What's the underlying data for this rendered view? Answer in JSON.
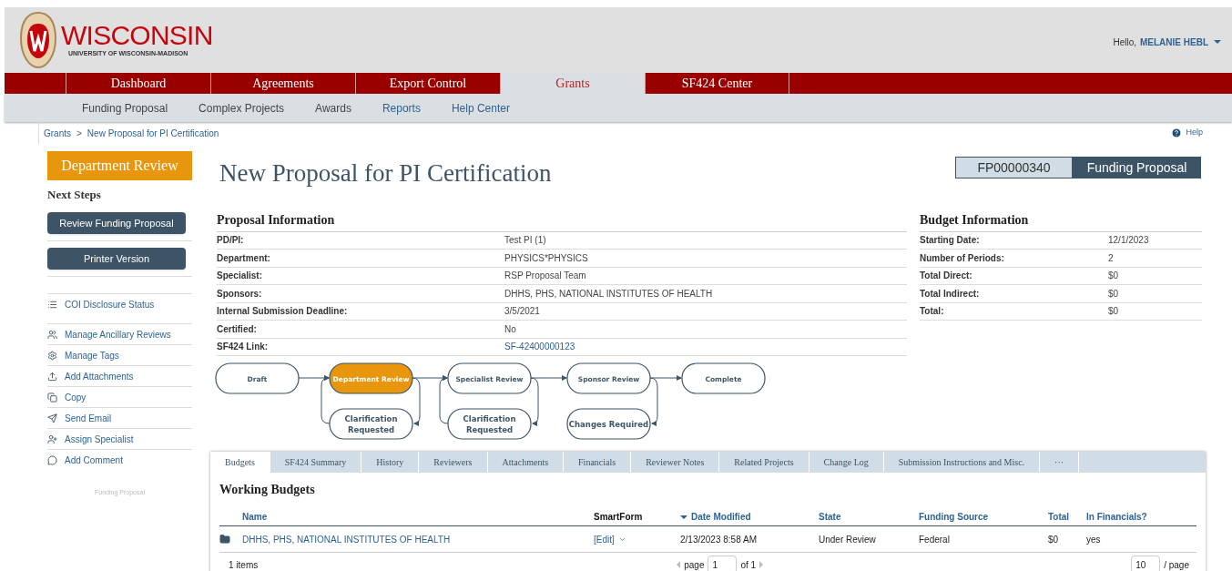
{
  "header": {
    "logo_title": "WISCONSIN",
    "logo_subtitle": "UNIVERSITY OF WISCONSIN-MADISON",
    "greeting": "Hello,",
    "user": "MELANIE HEBL"
  },
  "nav": [
    {
      "label": "Dashboard",
      "selected": false
    },
    {
      "label": "Agreements",
      "selected": false
    },
    {
      "label": "Export Control",
      "selected": false
    },
    {
      "label": "Grants",
      "selected": true
    },
    {
      "label": "SF424 Center",
      "selected": false
    }
  ],
  "subnav": [
    "Funding Proposal",
    "Complex Projects",
    "Awards",
    "Reports",
    "Help Center"
  ],
  "breadcrumb": {
    "items": [
      "Grants",
      "New Proposal for PI Certification"
    ],
    "separator": ">"
  },
  "help": "Help",
  "sidebar": {
    "state": "Department Review",
    "next_steps_title": "Next Steps",
    "buttons": [
      "Review Funding Proposal",
      "Printer Version"
    ],
    "actions": [
      {
        "kind": "list",
        "label": "COI Disclosure Status"
      },
      {
        "kind": "users",
        "label": "Manage Ancillary Reviews"
      },
      {
        "kind": "gear",
        "label": "Manage Tags"
      },
      {
        "kind": "upload",
        "label": "Add Attachments"
      },
      {
        "kind": "copy",
        "label": "Copy"
      },
      {
        "kind": "send",
        "label": "Send Email"
      },
      {
        "kind": "user-plus",
        "label": "Assign Specialist"
      },
      {
        "kind": "comment",
        "label": "Add Comment"
      }
    ],
    "footer": "Funding Proposal"
  },
  "title": "New Proposal for PI Certification",
  "record": {
    "id": "FP00000340",
    "type": "Funding Proposal"
  },
  "proposal_info": {
    "title": "Proposal Information",
    "rows": [
      {
        "label": "PD/PI:",
        "value": "Test PI (1)",
        "link": false
      },
      {
        "label": "Department:",
        "value": "PHYSICS*PHYSICS",
        "link": false
      },
      {
        "label": "Specialist:",
        "value": "RSP Proposal Team",
        "link": false
      },
      {
        "label": "Sponsors:",
        "value": "DHHS, PHS, NATIONAL INSTITUTES OF HEALTH",
        "link": false
      },
      {
        "label": "Internal Submission Deadline:",
        "value": "3/5/2021",
        "link": false
      },
      {
        "label": "Certified:",
        "value": "No",
        "link": false
      },
      {
        "label": "SF424 Link:",
        "value": "SF-42400000123",
        "link": true
      }
    ]
  },
  "budget_info": {
    "title": "Budget Information",
    "rows": [
      {
        "label": "Starting Date:",
        "value": "12/1/2023"
      },
      {
        "label": "Number of Periods:",
        "value": "2"
      },
      {
        "label": "Total Direct:",
        "value": "$0"
      },
      {
        "label": "Total Indirect:",
        "value": "$0"
      },
      {
        "label": "Total:",
        "value": "$0"
      }
    ]
  },
  "workflow": {
    "steps": [
      {
        "label": "Draft",
        "selected": false
      },
      {
        "label": "Department Review",
        "selected": true
      },
      {
        "label": "Specialist Review",
        "selected": false
      },
      {
        "label": "Sponsor Review",
        "selected": false
      },
      {
        "label": "Complete",
        "selected": false
      }
    ],
    "returns": [
      {
        "lines": [
          "Clarification",
          "Requested"
        ]
      },
      {
        "lines": [
          "Clarification",
          "Requested"
        ]
      },
      {
        "lines": [
          "Changes Required"
        ]
      }
    ]
  },
  "tabs": [
    {
      "label": "Budgets",
      "selected": true
    },
    {
      "label": "SF424 Summary",
      "selected": false
    },
    {
      "label": "History",
      "selected": false
    },
    {
      "label": "Reviewers",
      "selected": false
    },
    {
      "label": "Attachments",
      "selected": false
    },
    {
      "label": "Financials",
      "selected": false
    },
    {
      "label": "Reviewer Notes",
      "selected": false
    },
    {
      "label": "Related Projects",
      "selected": false
    },
    {
      "label": "Change Log",
      "selected": false
    },
    {
      "label": "Submission Instructions and Misc.",
      "selected": false
    },
    {
      "label": "···",
      "selected": false
    }
  ],
  "working_budgets": {
    "title": "Working Budgets",
    "columns": [
      {
        "label": "Name",
        "sorted": false
      },
      {
        "label": "SmartForm",
        "sorted": false
      },
      {
        "label": "Date Modified",
        "sorted": true
      },
      {
        "label": "State",
        "sorted": false
      },
      {
        "label": "Funding Source",
        "sorted": false
      },
      {
        "label": "Total",
        "sorted": false
      },
      {
        "label": "In Financials?",
        "sorted": false
      }
    ],
    "rows": [
      {
        "name": "DHHS, PHS, NATIONAL INSTITUTES OF HEALTH",
        "smartform": "[Edit]",
        "date": "2/13/2023 8:58 AM",
        "state": "Under Review",
        "source": "Federal",
        "total": "$0",
        "in_financials": "yes"
      }
    ],
    "footer": {
      "count": "1 items",
      "page_label": "page",
      "page": "1",
      "of": "of 1",
      "page_size": "10",
      "per_page": "/ page"
    }
  }
}
